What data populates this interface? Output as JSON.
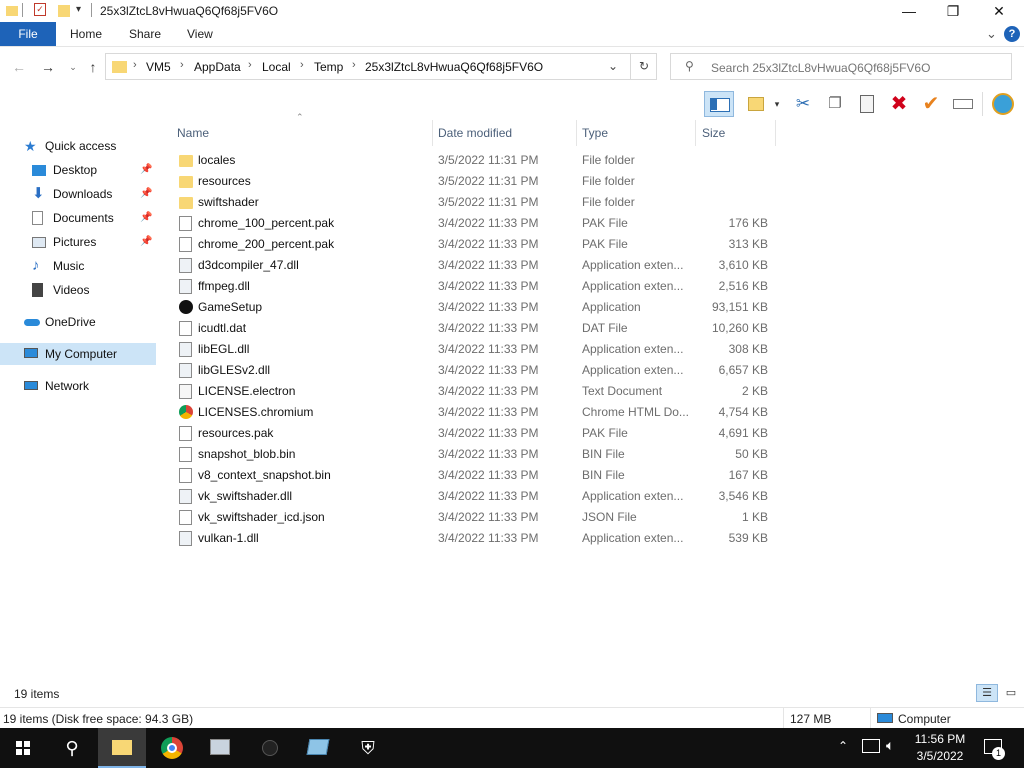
{
  "window": {
    "title": "25x3lZtcL8vHwuaQ6Qf68j5FV6O",
    "minimize": "—",
    "maximize": "❐",
    "close": "✕"
  },
  "ribbon": {
    "tabs": [
      "File",
      "Home",
      "Share",
      "View"
    ],
    "expand": "⌄",
    "help": "?"
  },
  "address": {
    "crumbs": [
      "VM5",
      "AppData",
      "Local",
      "Temp",
      "25x3lZtcL8vHwuaQ6Qf68j5FV6O"
    ],
    "search_placeholder": "Search 25x3lZtcL8vHwuaQ6Qf68j5FV6O"
  },
  "nav": {
    "quick_access": "Quick access",
    "items": [
      {
        "label": "Desktop",
        "pinned": true
      },
      {
        "label": "Downloads",
        "pinned": true
      },
      {
        "label": "Documents",
        "pinned": true
      },
      {
        "label": "Pictures",
        "pinned": true
      },
      {
        "label": "Music",
        "pinned": false
      },
      {
        "label": "Videos",
        "pinned": false
      }
    ],
    "onedrive": "OneDrive",
    "mycomputer": "My Computer",
    "network": "Network"
  },
  "columns": {
    "name": "Name",
    "date": "Date modified",
    "type": "Type",
    "size": "Size"
  },
  "files": [
    {
      "name": "locales",
      "date": "3/5/2022 11:31 PM",
      "type": "File folder",
      "size": "",
      "icon": "folder"
    },
    {
      "name": "resources",
      "date": "3/5/2022 11:31 PM",
      "type": "File folder",
      "size": "",
      "icon": "folder"
    },
    {
      "name": "swiftshader",
      "date": "3/5/2022 11:31 PM",
      "type": "File folder",
      "size": "",
      "icon": "folder"
    },
    {
      "name": "chrome_100_percent.pak",
      "date": "3/4/2022 11:33 PM",
      "type": "PAK File",
      "size": "176 KB",
      "icon": "file"
    },
    {
      "name": "chrome_200_percent.pak",
      "date": "3/4/2022 11:33 PM",
      "type": "PAK File",
      "size": "313 KB",
      "icon": "file"
    },
    {
      "name": "d3dcompiler_47.dll",
      "date": "3/4/2022 11:33 PM",
      "type": "Application exten...",
      "size": "3,610 KB",
      "icon": "dll"
    },
    {
      "name": "ffmpeg.dll",
      "date": "3/4/2022 11:33 PM",
      "type": "Application exten...",
      "size": "2,516 KB",
      "icon": "dll"
    },
    {
      "name": "GameSetup",
      "date": "3/4/2022 11:33 PM",
      "type": "Application",
      "size": "93,151 KB",
      "icon": "app"
    },
    {
      "name": "icudtl.dat",
      "date": "3/4/2022 11:33 PM",
      "type": "DAT File",
      "size": "10,260 KB",
      "icon": "file"
    },
    {
      "name": "libEGL.dll",
      "date": "3/4/2022 11:33 PM",
      "type": "Application exten...",
      "size": "308 KB",
      "icon": "dll"
    },
    {
      "name": "libGLESv2.dll",
      "date": "3/4/2022 11:33 PM",
      "type": "Application exten...",
      "size": "6,657 KB",
      "icon": "dll"
    },
    {
      "name": "LICENSE.electron",
      "date": "3/4/2022 11:33 PM",
      "type": "Text Document",
      "size": "2 KB",
      "icon": "text"
    },
    {
      "name": "LICENSES.chromium",
      "date": "3/4/2022 11:33 PM",
      "type": "Chrome HTML Do...",
      "size": "4,754 KB",
      "icon": "chrome"
    },
    {
      "name": "resources.pak",
      "date": "3/4/2022 11:33 PM",
      "type": "PAK File",
      "size": "4,691 KB",
      "icon": "file"
    },
    {
      "name": "snapshot_blob.bin",
      "date": "3/4/2022 11:33 PM",
      "type": "BIN File",
      "size": "50 KB",
      "icon": "file"
    },
    {
      "name": "v8_context_snapshot.bin",
      "date": "3/4/2022 11:33 PM",
      "type": "BIN File",
      "size": "167 KB",
      "icon": "file"
    },
    {
      "name": "vk_swiftshader.dll",
      "date": "3/4/2022 11:33 PM",
      "type": "Application exten...",
      "size": "3,546 KB",
      "icon": "dll"
    },
    {
      "name": "vk_swiftshader_icd.json",
      "date": "3/4/2022 11:33 PM",
      "type": "JSON File",
      "size": "1 KB",
      "icon": "file"
    },
    {
      "name": "vulkan-1.dll",
      "date": "3/4/2022 11:33 PM",
      "type": "Application exten...",
      "size": "539 KB",
      "icon": "dll"
    }
  ],
  "status": {
    "item_count": "19 items",
    "disk": "19 items (Disk free space: 94.3 GB)",
    "size": "127 MB",
    "location": "Computer"
  },
  "taskbar": {
    "time": "11:56 PM",
    "date": "3/5/2022",
    "notification_count": "1"
  },
  "colors": {
    "accent": "#1e63b8",
    "selection": "#cce4f7",
    "folder": "#f8d775",
    "taskbar": "#101010"
  }
}
